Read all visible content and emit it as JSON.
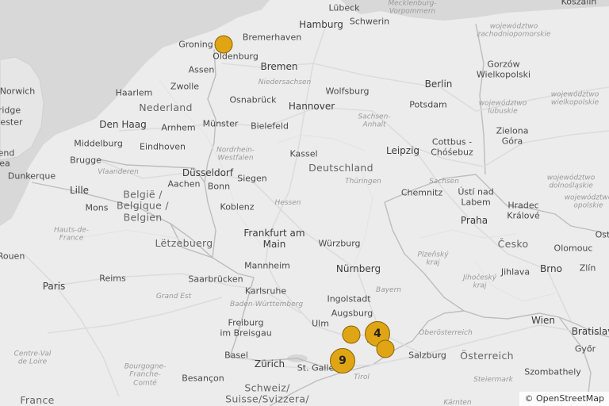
{
  "attribution": "© OpenStreetMap",
  "markers": [
    {
      "id": "groningen",
      "label": "",
      "count": null
    },
    {
      "id": "cluster-munich-4",
      "label": "4",
      "count": 4
    },
    {
      "id": "munich-west",
      "label": "",
      "count": null
    },
    {
      "id": "munich-southeast",
      "label": "",
      "count": null
    },
    {
      "id": "cluster-allgaeu-9",
      "label": "9",
      "count": 9
    }
  ],
  "labels": [
    {
      "id": "luebeck",
      "text": "Lübeck",
      "kind": "city"
    },
    {
      "id": "mecklenburg",
      "text": "Mecklenburg-\nVorpommern",
      "kind": "region"
    },
    {
      "id": "koszalin",
      "text": "Koszalin",
      "kind": "city"
    },
    {
      "id": "hamburg",
      "text": "Hamburg",
      "kind": "bigcity"
    },
    {
      "id": "schwerin",
      "text": "Schwerin",
      "kind": "city"
    },
    {
      "id": "bremerhaven",
      "text": "Bremerhaven",
      "kind": "city"
    },
    {
      "id": "groningen",
      "text": "Groning",
      "kind": "city"
    },
    {
      "id": "oldenburg",
      "text": "Oldenburg",
      "kind": "city"
    },
    {
      "id": "bremen",
      "text": "Bremen",
      "kind": "bigcity"
    },
    {
      "id": "zachodnio",
      "text": "województwo\nzachodniopomorskie",
      "kind": "region"
    },
    {
      "id": "norwich",
      "text": "Norwich",
      "kind": "city"
    },
    {
      "id": "assen",
      "text": "Assen",
      "kind": "city"
    },
    {
      "id": "zwolle",
      "text": "Zwolle",
      "kind": "city"
    },
    {
      "id": "niedersachsen",
      "text": "Niedersachsen",
      "kind": "region"
    },
    {
      "id": "berlin",
      "text": "Berlin",
      "kind": "bigcity"
    },
    {
      "id": "gorzow",
      "text": "Gorzów\nWielkopolski",
      "kind": "city"
    },
    {
      "id": "haarlem",
      "text": "Haarlem",
      "kind": "city"
    },
    {
      "id": "nederland",
      "text": "Nederland",
      "kind": "country"
    },
    {
      "id": "osnabrueck",
      "text": "Osnabrück",
      "kind": "city"
    },
    {
      "id": "hannover",
      "text": "Hannover",
      "kind": "bigcity"
    },
    {
      "id": "wolfsburg",
      "text": "Wolfsburg",
      "kind": "city"
    },
    {
      "id": "potsdam",
      "text": "Potsdam",
      "kind": "city"
    },
    {
      "id": "wielkopolskie",
      "text": "województwo\nwielkopolskie",
      "kind": "region"
    },
    {
      "id": "ridge",
      "text": "ridge",
      "kind": "city"
    },
    {
      "id": "hester",
      "text": "hester",
      "kind": "city"
    },
    {
      "id": "denhaag",
      "text": "Den Haag",
      "kind": "bigcity"
    },
    {
      "id": "arnhem",
      "text": "Arnhem",
      "kind": "city"
    },
    {
      "id": "muenster",
      "text": "Münster",
      "kind": "city"
    },
    {
      "id": "bielefeld",
      "text": "Bielefeld",
      "kind": "city"
    },
    {
      "id": "sachsenanhalt",
      "text": "Sachsen-\nAnhalt",
      "kind": "region"
    },
    {
      "id": "lubuskie",
      "text": "województwo\nlubuskie",
      "kind": "region"
    },
    {
      "id": "zielona",
      "text": "Zielona\nGóra",
      "kind": "city"
    },
    {
      "id": "middelburg",
      "text": "Middelburg",
      "kind": "city"
    },
    {
      "id": "eindhoven",
      "text": "Eindhoven",
      "kind": "city"
    },
    {
      "id": "nrw",
      "text": "Nordrhein-\nWestfalen",
      "kind": "region"
    },
    {
      "id": "kassel",
      "text": "Kassel",
      "kind": "city"
    },
    {
      "id": "leipzig",
      "text": "Leipzig",
      "kind": "bigcity"
    },
    {
      "id": "cottbus",
      "text": "Cottbus -\nChóśebuz",
      "kind": "city"
    },
    {
      "id": "end",
      "text": "end",
      "kind": "city"
    },
    {
      "id": "ea",
      "text": "ea",
      "kind": "city"
    },
    {
      "id": "brugge",
      "text": "Brugge",
      "kind": "city"
    },
    {
      "id": "duesseldorf",
      "text": "Düsseldorf",
      "kind": "bigcity"
    },
    {
      "id": "deutschland",
      "text": "Deutschland",
      "kind": "country"
    },
    {
      "id": "dunkerque",
      "text": "Dunkerque",
      "kind": "city"
    },
    {
      "id": "vlaanderen",
      "text": "Vlaanderen",
      "kind": "region"
    },
    {
      "id": "siegen",
      "text": "Siegen",
      "kind": "city"
    },
    {
      "id": "thueringen",
      "text": "Thüringen",
      "kind": "region"
    },
    {
      "id": "dolnoslaskie",
      "text": "województwo\ndolnośląskie",
      "kind": "region"
    },
    {
      "id": "lille",
      "text": "Lille",
      "kind": "bigcity"
    },
    {
      "id": "aachen",
      "text": "Aachen",
      "kind": "city"
    },
    {
      "id": "bonn",
      "text": "Bonn",
      "kind": "city"
    },
    {
      "id": "sachsen",
      "text": "Sachsen",
      "kind": "region"
    },
    {
      "id": "chemnitz",
      "text": "Chemnitz",
      "kind": "city"
    },
    {
      "id": "usti",
      "text": "Ústí nad\nLabem",
      "kind": "city"
    },
    {
      "id": "belgie",
      "text": "België /\nBelgique /\nBelgien",
      "kind": "country"
    },
    {
      "id": "mons",
      "text": "Mons",
      "kind": "city"
    },
    {
      "id": "hessen",
      "text": "Hessen",
      "kind": "region"
    },
    {
      "id": "koblenz",
      "text": "Koblenz",
      "kind": "city"
    },
    {
      "id": "hradec",
      "text": "Hradec\nKrálové",
      "kind": "city"
    },
    {
      "id": "opolskie",
      "text": "województwo\nopolskie",
      "kind": "region"
    },
    {
      "id": "praha",
      "text": "Praha",
      "kind": "bigcity"
    },
    {
      "id": "hautsdefrance",
      "text": "Hauts-de-\nFrance",
      "kind": "region"
    },
    {
      "id": "frankfurt",
      "text": "Frankfurt am\nMain",
      "kind": "bigcity"
    },
    {
      "id": "letzebuerg",
      "text": "Lëtzebuerg",
      "kind": "country"
    },
    {
      "id": "wuerzburg",
      "text": "Würzburg",
      "kind": "city"
    },
    {
      "id": "cesko",
      "text": "Česko",
      "kind": "country"
    },
    {
      "id": "ost",
      "text": "Ost",
      "kind": "city"
    },
    {
      "id": "rouen",
      "text": "Rouen",
      "kind": "city"
    },
    {
      "id": "mannheim",
      "text": "Mannheim",
      "kind": "city"
    },
    {
      "id": "nuernberg",
      "text": "Nürnberg",
      "kind": "bigcity"
    },
    {
      "id": "plzensky",
      "text": "Plzeňský\nkraj",
      "kind": "region"
    },
    {
      "id": "olomouc",
      "text": "Olomouc",
      "kind": "city"
    },
    {
      "id": "brno",
      "text": "Brno",
      "kind": "bigcity"
    },
    {
      "id": "zlin",
      "text": "Zlín",
      "kind": "city"
    },
    {
      "id": "jihocesky",
      "text": "Jihočeský\nkraj",
      "kind": "region"
    },
    {
      "id": "jihlava",
      "text": "Jihlava",
      "kind": "city"
    },
    {
      "id": "paris",
      "text": "Paris",
      "kind": "bigcity"
    },
    {
      "id": "reims",
      "text": "Reims",
      "kind": "city"
    },
    {
      "id": "saarbruecken",
      "text": "Saarbrücken",
      "kind": "city"
    },
    {
      "id": "karlsruhe",
      "text": "Karlsruhe",
      "kind": "city"
    },
    {
      "id": "bayern",
      "text": "Bayern",
      "kind": "region"
    },
    {
      "id": "grandest",
      "text": "Grand Est",
      "kind": "region"
    },
    {
      "id": "bawue",
      "text": "Baden-Württemberg",
      "kind": "region"
    },
    {
      "id": "ingolstadt",
      "text": "Ingolstadt",
      "kind": "city"
    },
    {
      "id": "augsburg",
      "text": "Augsburg",
      "kind": "city"
    },
    {
      "id": "wien",
      "text": "Wien",
      "kind": "bigcity"
    },
    {
      "id": "bratislava",
      "text": "Bratislav",
      "kind": "bigcity"
    },
    {
      "id": "freiburg",
      "text": "Freiburg\nim Breisgau",
      "kind": "city"
    },
    {
      "id": "ulm",
      "text": "Ulm",
      "kind": "city"
    },
    {
      "id": "muenchen",
      "text": "n",
      "kind": "bigcity"
    },
    {
      "id": "oberoesterreich",
      "text": "Oberösterreich",
      "kind": "region"
    },
    {
      "id": "centrevaldeloire",
      "text": "Centre-Val\nde Loire",
      "kind": "region"
    },
    {
      "id": "basel",
      "text": "Basel",
      "kind": "city"
    },
    {
      "id": "salzburg",
      "text": "Salzburg",
      "kind": "city"
    },
    {
      "id": "oesterreich",
      "text": "Österreich",
      "kind": "country"
    },
    {
      "id": "gyor",
      "text": "Győr",
      "kind": "city"
    },
    {
      "id": "zuerich",
      "text": "Zürich",
      "kind": "bigcity"
    },
    {
      "id": "stgallen",
      "text": "St. Galle",
      "kind": "city"
    },
    {
      "id": "bourgogne",
      "text": "Bourgogne-\nFranche-\nComté",
      "kind": "region"
    },
    {
      "id": "tirol",
      "text": "Tirol",
      "kind": "region"
    },
    {
      "id": "szombathely",
      "text": "Szombathely",
      "kind": "city"
    },
    {
      "id": "besancon",
      "text": "Besançon",
      "kind": "city"
    },
    {
      "id": "steiermark",
      "text": "Steiermark",
      "kind": "region"
    },
    {
      "id": "schweiz",
      "text": "Schweiz/\nSuisse/Svizzera/",
      "kind": "country"
    },
    {
      "id": "france",
      "text": "France",
      "kind": "country"
    },
    {
      "id": "karnten",
      "text": "Kärnten",
      "kind": "region"
    }
  ]
}
